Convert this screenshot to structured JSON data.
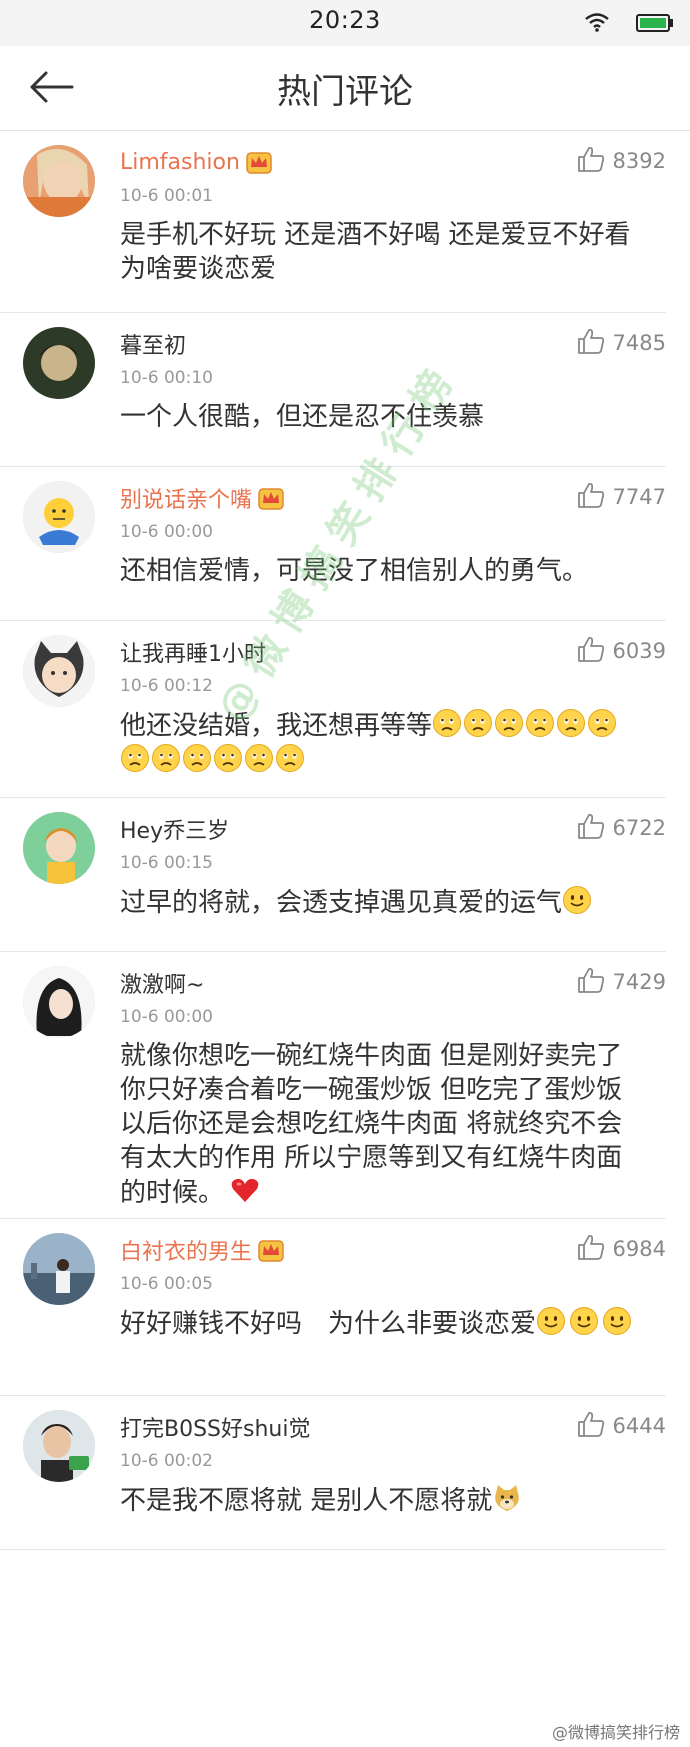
{
  "status_bar": {
    "time": "20:23"
  },
  "header": {
    "title": "热门评论"
  },
  "comments": [
    {
      "user": "Limfashion",
      "vip": true,
      "time": "10-6 00:01",
      "likes": "8392",
      "text": "是手机不好玩 还是酒不好喝 还是爱豆不好看 为啥要谈恋爱"
    },
    {
      "user": "暮至初",
      "vip": false,
      "time": "10-6 00:10",
      "likes": "7485",
      "text": "一个人很酷，但还是忍不住羡慕"
    },
    {
      "user": "别说话亲个嘴",
      "vip": true,
      "time": "10-6 00:00",
      "likes": "7747",
      "text": "还相信爱情，可是没了相信别人的勇气。"
    },
    {
      "user": "让我再睡1小时",
      "vip": false,
      "time": "10-6 00:12",
      "likes": "6039",
      "text": "他还没结婚，我还想再等等"
    },
    {
      "user": "Hey乔三岁",
      "vip": false,
      "time": "10-6 00:15",
      "likes": "6722",
      "text": "过早的将就，会透支掉遇见真爱的运气"
    },
    {
      "user": "激激啊~",
      "vip": false,
      "time": "10-6 00:00",
      "likes": "7429",
      "text": "就像你想吃一碗红烧牛肉面 但是刚好卖完了 你只好凑合着吃一碗蛋炒饭 但吃完了蛋炒饭以后你还是会想吃红烧牛肉面 将就终究不会有太大的作用 所以宁愿等到又有红烧牛肉面的时候。"
    },
    {
      "user": "白衬衣的男生",
      "vip": true,
      "time": "10-6 00:05",
      "likes": "6984",
      "text": "好好赚钱不好吗　为什么非要谈恋爱"
    },
    {
      "user": "打完B0SS好shui觉",
      "vip": false,
      "time": "10-6 00:02",
      "likes": "6444",
      "text": "不是我不愿将就 是别人不愿将就"
    }
  ],
  "watermark": "@微博搞笑排行榜",
  "footer_mark": "@微博搞笑排行榜",
  "colors": {
    "vip_name": "#eb7350",
    "text": "#333333",
    "meta": "#999999"
  }
}
